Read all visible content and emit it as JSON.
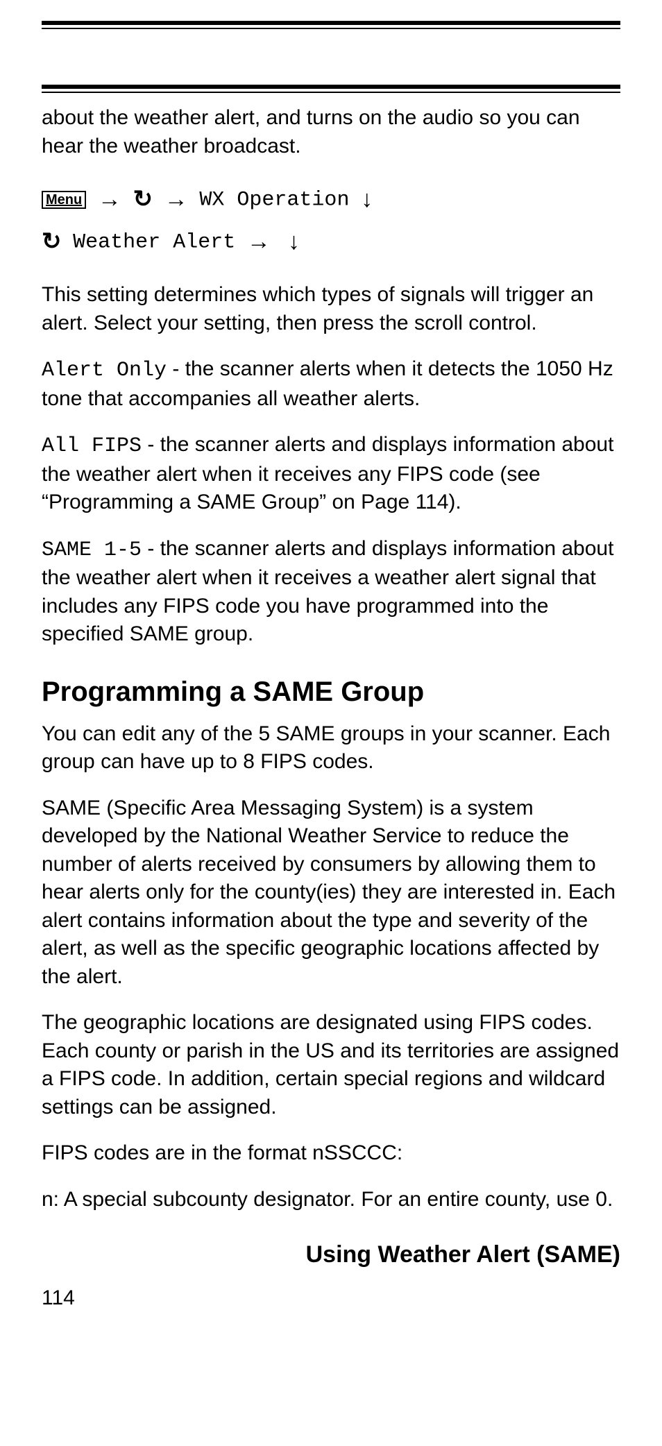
{
  "intro_continuation": "about the weather alert, and turns on the audio so you can hear the weather broadcast.",
  "nav": {
    "menu_label": "Menu",
    "arrow_right": "→",
    "rotate": "↻",
    "arrow_down": "↓",
    "item1": "WX Operation",
    "item2": "Weather Alert"
  },
  "setting_intro": "This setting determines which types of signals will trigger an alert. Select your setting, then press the scroll control.",
  "opts": {
    "alert_only": {
      "label": "Alert Only",
      "desc": " - the scanner alerts when it detects the 1050 Hz tone that accompanies all weather alerts."
    },
    "all_fips": {
      "label": "All FIPS",
      "desc": " - the scanner alerts and displays information about the weather alert when it receives any FIPS code (see “Programming a SAME Group” on Page 114)."
    },
    "same15": {
      "label": "SAME 1-5",
      "desc": " - the scanner alerts and displays information about the weather alert when it receives a weather alert signal that includes any FIPS code you have programmed into the specified SAME group."
    }
  },
  "section_heading": "Programming a SAME Group",
  "p_groups": "You can edit any of the 5 SAME groups in your scanner. Each group can have up to 8 FIPS codes.",
  "p_same_def": "SAME (Specific Area Messaging System) is a system developed by the National Weather Service to reduce the number of alerts received by consumers by allowing them to hear alerts only for the county(ies) they are interested in. Each alert contains information about the type and severity of the alert, as well as the specific geographic locations affected by the alert.",
  "p_fips": "The geographic locations are designated using FIPS codes. Each county or parish in the US and its territories are assigned a FIPS code. In addition, certain special regions and wildcard settings can be assigned.",
  "p_format": "FIPS codes are in the format nSSCCC:",
  "p_n": "n: A special subcounty designator. For an entire county, use 0.",
  "footer_title": "Using Weather Alert (SAME)",
  "page_number": "114"
}
